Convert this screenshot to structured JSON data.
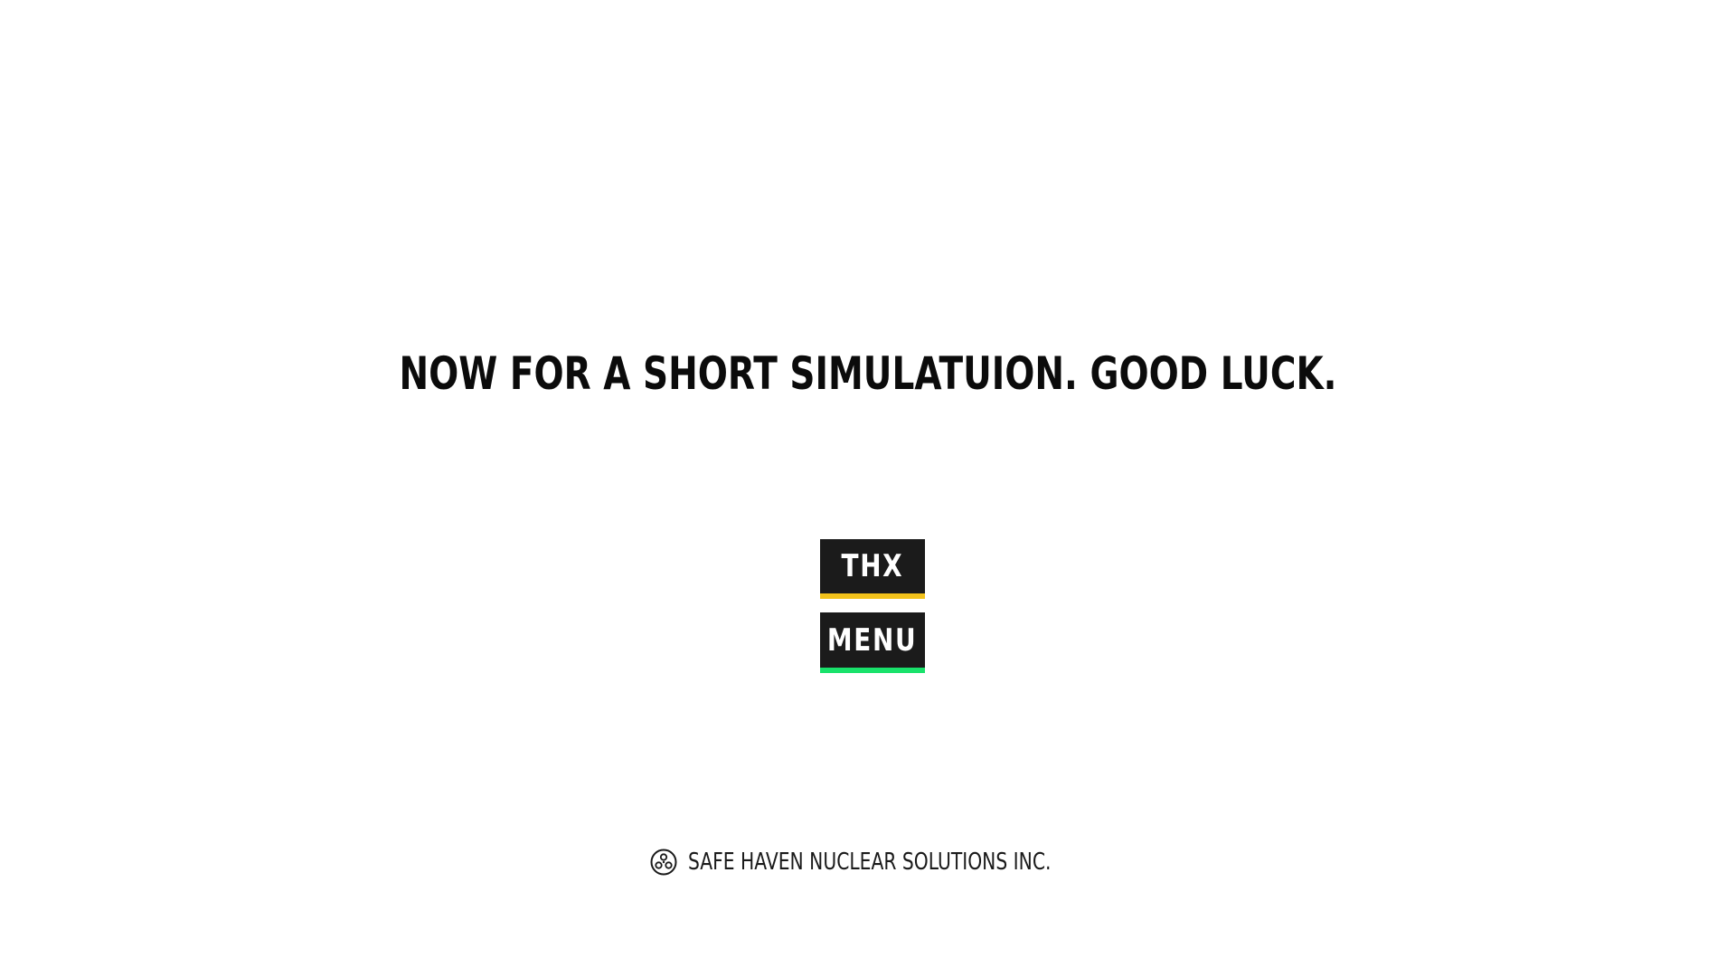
{
  "main": {
    "headline": "NOW FOR A SHORT SIMULATUION. GOOD LUCK."
  },
  "buttons": {
    "thx_label": "THX",
    "menu_label": "MENU"
  },
  "footer": {
    "company_name": "SAFE HAVEN NUCLEAR SOLUTIONS INC.",
    "logo_icon": "three-circle-logo-icon"
  },
  "colors": {
    "background": "#ffffff",
    "button_bg": "#1b1b1b",
    "thx_accent": "#f2c21b",
    "menu_accent": "#19e26b",
    "text": "#0b0b0b"
  }
}
